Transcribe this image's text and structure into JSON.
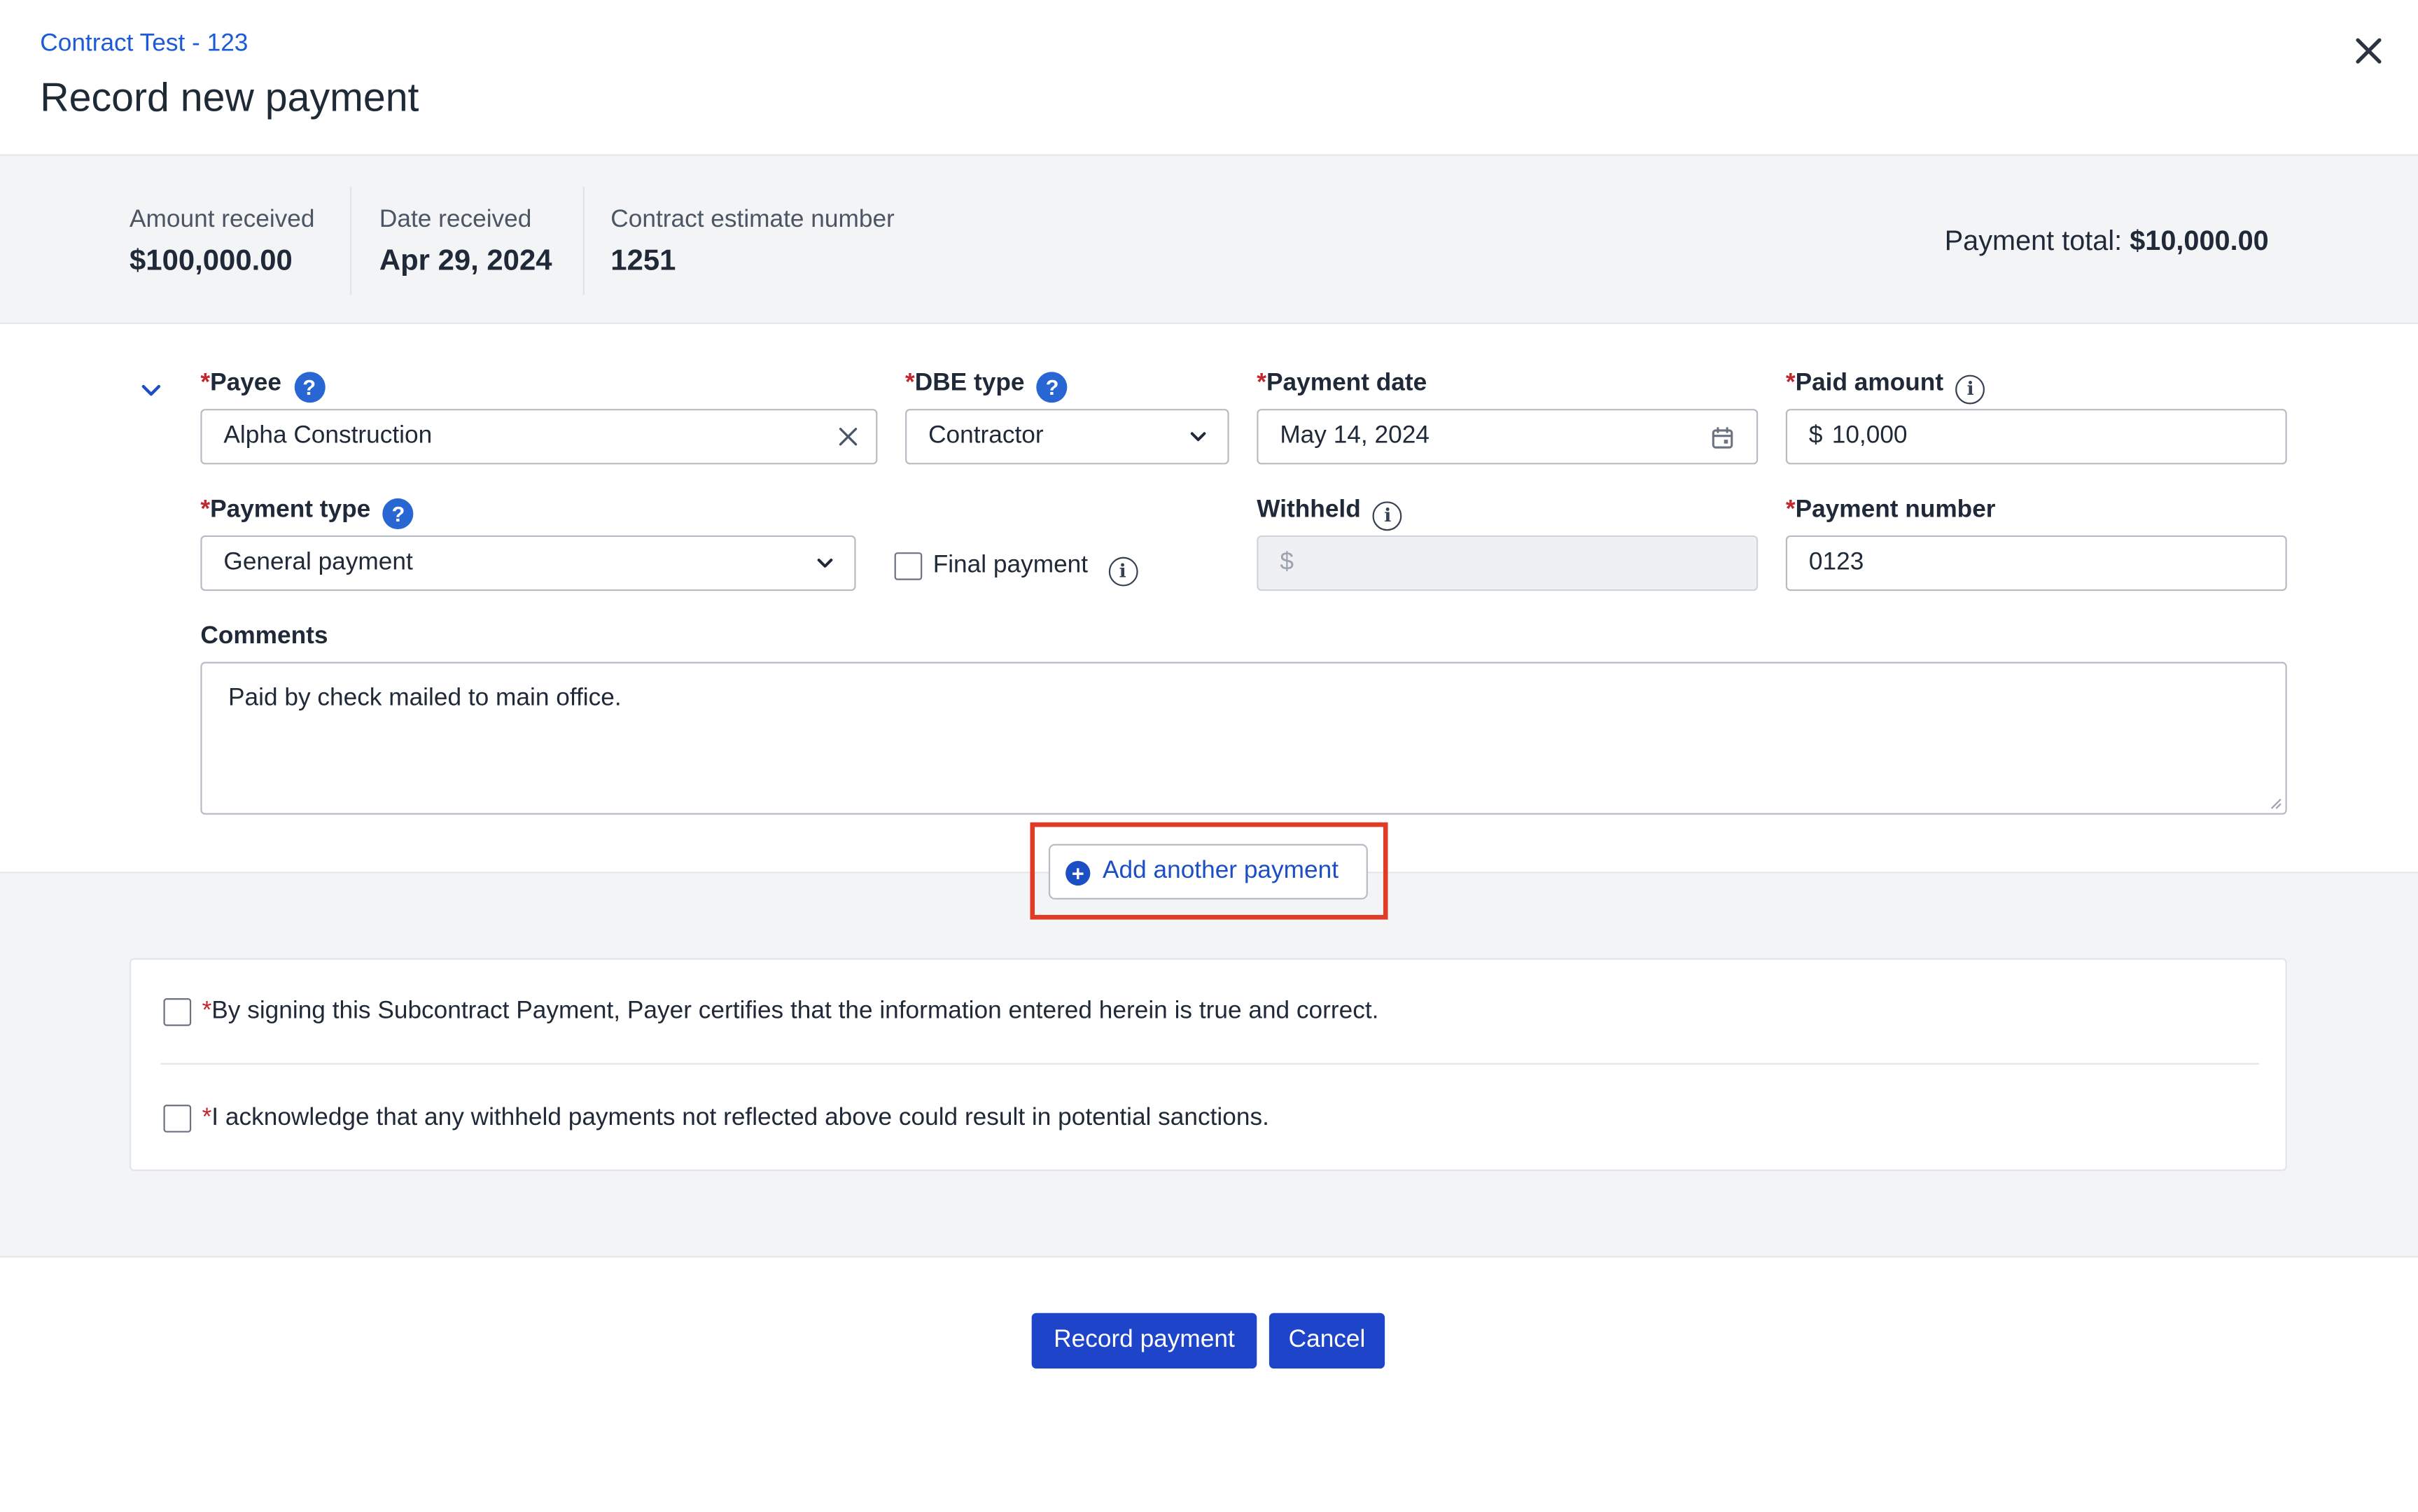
{
  "header": {
    "breadcrumb": "Contract Test - 123",
    "title": "Record new payment",
    "close_icon": "close-icon"
  },
  "summary": {
    "amount_received": {
      "label": "Amount received",
      "value": "$100,000.00"
    },
    "date_received": {
      "label": "Date received",
      "value": "Apr 29, 2024"
    },
    "contract_estimate": {
      "label": "Contract estimate number",
      "value": "1251"
    },
    "payment_total_label": "Payment total:",
    "payment_total_value": "$10,000.00"
  },
  "form": {
    "required_mark": "*",
    "payee": {
      "label": "Payee",
      "value": "Alpha Construction"
    },
    "dbe_type": {
      "label": "DBE type",
      "value": "Contractor"
    },
    "payment_date": {
      "label": "Payment date",
      "value": "May 14, 2024"
    },
    "paid_amount": {
      "label": "Paid amount",
      "prefix": "$",
      "value": "10,000"
    },
    "payment_type": {
      "label": "Payment type",
      "value": "General payment"
    },
    "final_payment": {
      "label": "Final payment",
      "checked": false
    },
    "withheld": {
      "label": "Withheld",
      "prefix": "$",
      "value": ""
    },
    "payment_number": {
      "label": "Payment number",
      "value": "0123"
    },
    "comments": {
      "label": "Comments",
      "value": "Paid by check mailed to main office."
    }
  },
  "actions": {
    "add_another": "Add another payment",
    "record": "Record payment",
    "cancel": "Cancel"
  },
  "certifications": [
    {
      "text": "By signing this Subcontract Payment, Payer certifies that the information entered herein is true and correct.",
      "checked": false
    },
    {
      "text": "I acknowledge that any withheld payments not reflected above could result in potential sanctions.",
      "checked": false
    }
  ],
  "colors": {
    "accent": "#1d4fc4",
    "primary_button": "#1e45c9",
    "required": "#c2262e",
    "highlight": "#e03b24"
  }
}
